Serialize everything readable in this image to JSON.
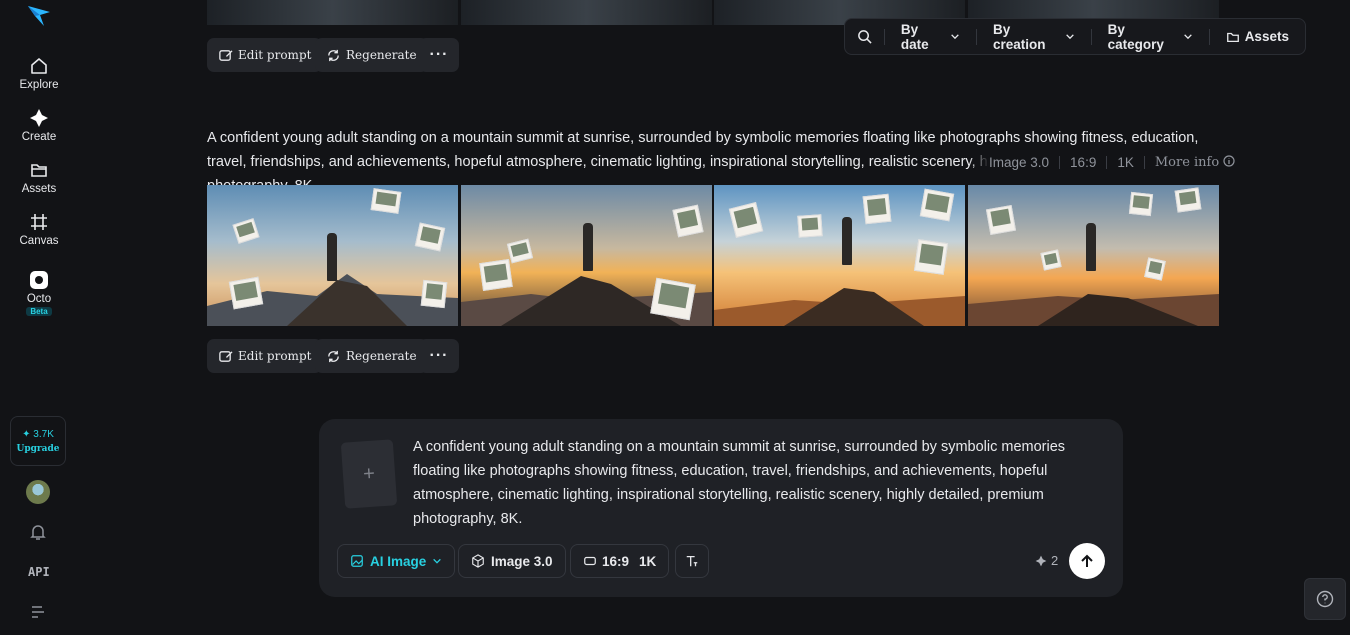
{
  "sidebar": {
    "logo": "lightning-logo",
    "items": [
      {
        "label": "Explore",
        "icon": "home-icon"
      },
      {
        "label": "Create",
        "icon": "sparkle-icon"
      },
      {
        "label": "Assets",
        "icon": "folder-icon"
      },
      {
        "label": "Canvas",
        "icon": "canvas-icon"
      },
      {
        "label": "Octo",
        "icon": "octo-icon",
        "badge": "Beta"
      }
    ],
    "credits": {
      "value": "3.7K",
      "action": "Upgrade"
    },
    "api_label": "API"
  },
  "filterbar": {
    "by_date": "By date",
    "by_creation": "By creation",
    "by_category": "By category",
    "assets": "Assets"
  },
  "generations": [
    {
      "actions": {
        "edit": "Edit prompt",
        "regenerate": "Regenerate"
      }
    },
    {
      "prompt": "A confident young adult standing on a mountain summit at sunrise, surrounded by symbolic memories floating like photographs showing fitness, education, travel, friendships, and achievements, hopeful atmosphere, cinematic lighting, inspirational storytelling, realistic scenery, highly detailed, premium photography, 8K.",
      "model": "Image 3.0",
      "ratio": "16:9",
      "resolution": "1K",
      "more_info": "More info",
      "actions": {
        "edit": "Edit prompt",
        "regenerate": "Regenerate"
      }
    }
  ],
  "composer": {
    "prompt": "A confident young adult standing on a mountain summit at sunrise, surrounded by symbolic memories floating like photographs showing fitness, education, travel, friendships, and achievements, hopeful atmosphere, cinematic lighting, inspirational storytelling, realistic scenery, highly detailed, premium photography, 8K.",
    "upload_symbol": "+",
    "mode": "AI Image",
    "model": "Image 3.0",
    "ratio": "16:9",
    "resolution": "1K",
    "cost": "2"
  },
  "colors": {
    "accent": "#28d0e0",
    "background": "#121316",
    "panel": "#1f2126"
  }
}
